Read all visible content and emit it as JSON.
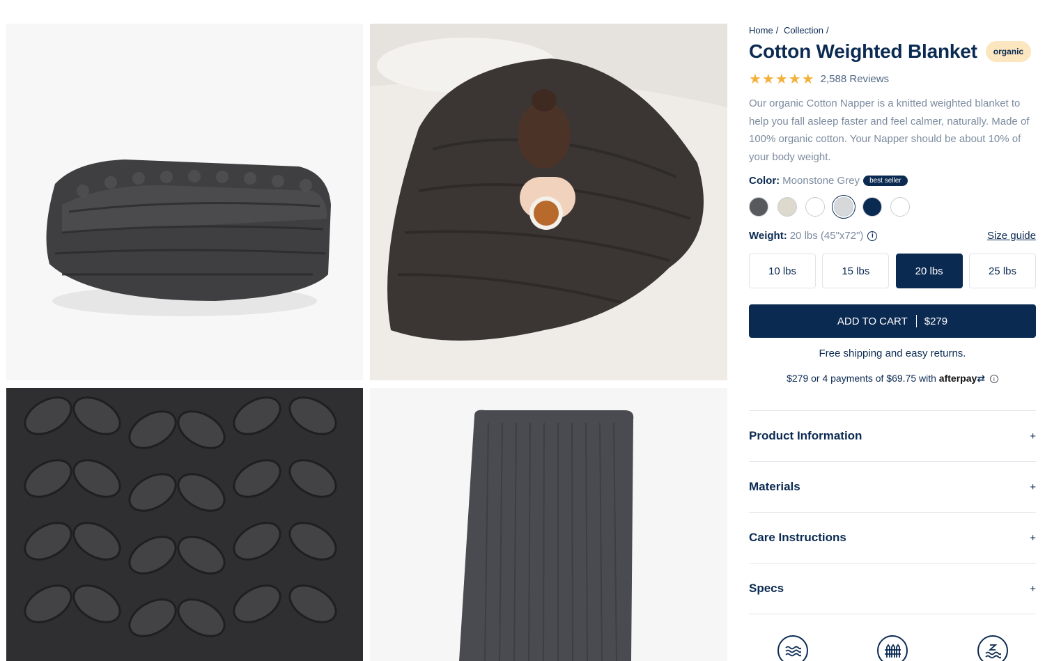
{
  "breadcrumb": {
    "items": [
      "Home",
      "Collection"
    ]
  },
  "product": {
    "title": "Cotton Weighted Blanket",
    "badge": "organic",
    "stars": "★★★★★",
    "reviews": "2,588 Reviews",
    "description": "Our organic Cotton Napper is a knitted weighted blanket to help you fall asleep faster and feel calmer, naturally. Made of 100% organic cotton. Your Napper should be about 10% of your body weight."
  },
  "color": {
    "label": "Color:",
    "value": "Moonstone Grey",
    "tag": "best seller",
    "swatches": [
      "#58595b",
      "#ddd9cc",
      "#ffffff",
      "#d6d8da",
      "#0b2a52",
      "#ffffff"
    ],
    "selected_index": 3
  },
  "weight": {
    "label": "Weight:",
    "value": "20 lbs (45\"x72\")",
    "size_guide": "Size guide",
    "options": [
      "10 lbs",
      "15 lbs",
      "20 lbs",
      "25 lbs"
    ],
    "selected": "20 lbs"
  },
  "cart": {
    "label": "ADD TO CART",
    "price": "$279"
  },
  "shipping": "Free shipping and easy returns.",
  "afterpay": {
    "text": "$279 or 4 payments of $69.75 with",
    "brand": "afterpay"
  },
  "accordion": [
    "Product Information",
    "Materials",
    "Care Instructions",
    "Specs"
  ],
  "colors": {
    "navy": "#0b2a52",
    "star": "#f3b13b",
    "badge_bg": "#fbe6c0",
    "blanket": "#3d3c3d"
  },
  "features": [
    "water-waves-icon",
    "fence-icon",
    "sleep-z-icon"
  ]
}
